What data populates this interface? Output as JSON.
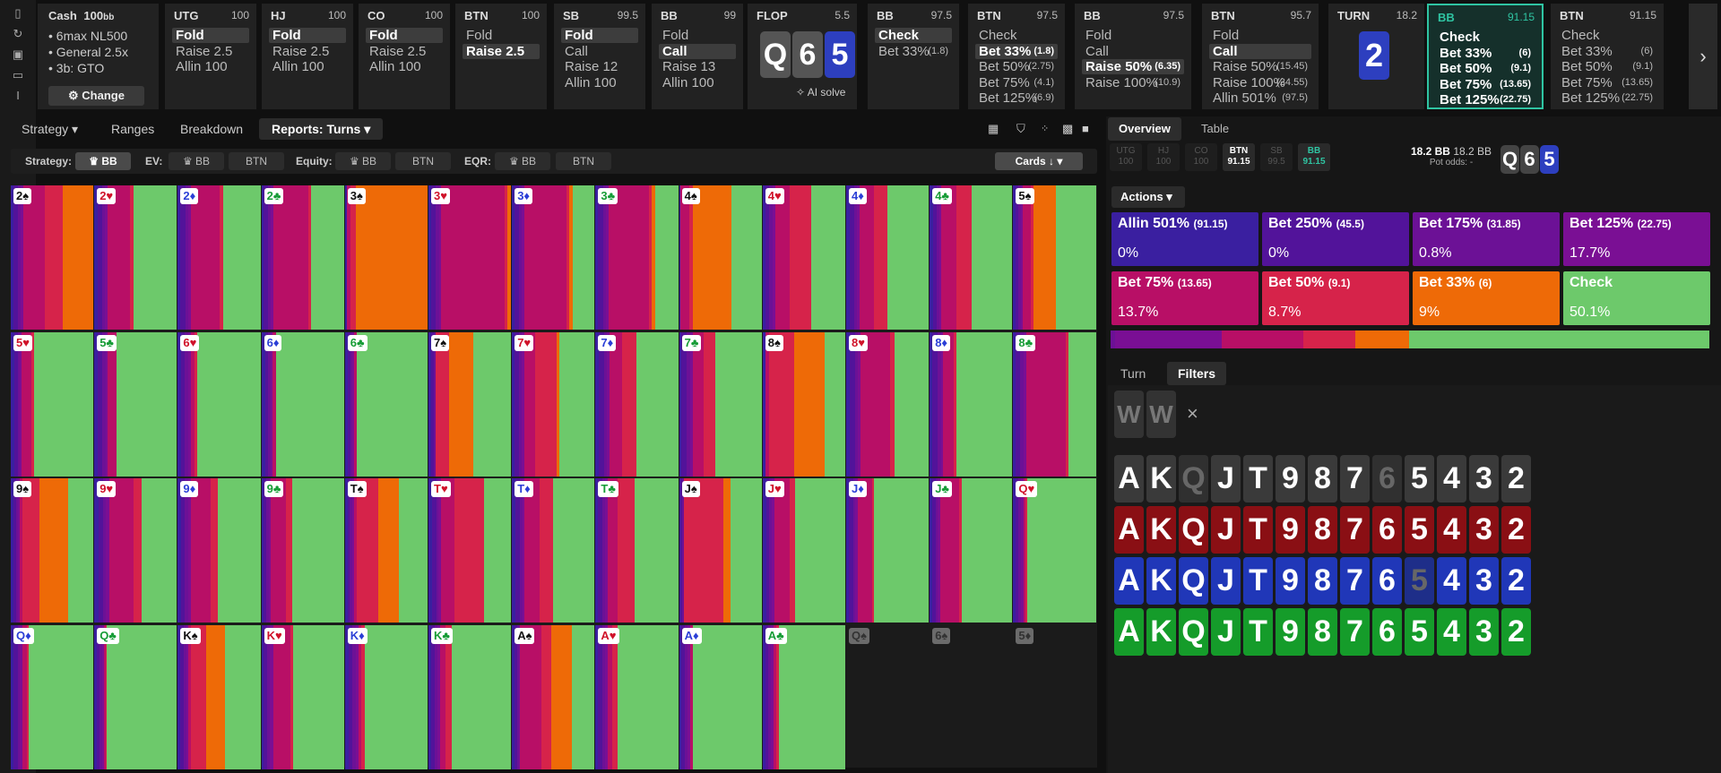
{
  "header": {
    "cash": "Cash",
    "stake": "100",
    "stake_unit": "bb",
    "bullets": [
      "6max NL500",
      "General 2.5x",
      "3b: GTO"
    ],
    "change": "Change",
    "ai_solve": "AI solve"
  },
  "columns": [
    {
      "name": "UTG",
      "stack": "100",
      "opts": [
        {
          "l": "Fold",
          "sel": true
        },
        {
          "l": "Raise 2.5"
        },
        {
          "l": "Allin 100"
        }
      ]
    },
    {
      "name": "HJ",
      "stack": "100",
      "opts": [
        {
          "l": "Fold",
          "sel": true
        },
        {
          "l": "Raise 2.5"
        },
        {
          "l": "Allin 100"
        }
      ]
    },
    {
      "name": "CO",
      "stack": "100",
      "opts": [
        {
          "l": "Fold",
          "sel": true
        },
        {
          "l": "Raise 2.5"
        },
        {
          "l": "Allin 100"
        }
      ]
    },
    {
      "name": "BTN",
      "stack": "100",
      "opts": [
        {
          "l": "Fold"
        },
        {
          "l": "Raise 2.5",
          "sel": true
        }
      ]
    },
    {
      "name": "SB",
      "stack": "99.5",
      "opts": [
        {
          "l": "Fold",
          "sel": true
        },
        {
          "l": "Call"
        },
        {
          "l": "Raise 12"
        },
        {
          "l": "Allin 100"
        }
      ]
    },
    {
      "name": "BB",
      "stack": "99",
      "opts": [
        {
          "l": "Fold"
        },
        {
          "l": "Call",
          "sel": true
        },
        {
          "l": "Raise 13"
        },
        {
          "l": "Allin 100"
        }
      ]
    },
    {
      "name": "FLOP",
      "stack": "5.5",
      "flop": true
    },
    {
      "name": "BB",
      "stack": "97.5",
      "opts": [
        {
          "l": "Check",
          "sel": true
        },
        {
          "l": "Bet 33%",
          "a": "(1.8)"
        }
      ]
    },
    {
      "name": "BTN",
      "stack": "97.5",
      "opts": [
        {
          "l": "Check"
        },
        {
          "l": "Bet 33%",
          "a": "(1.8)",
          "sel": true
        },
        {
          "l": "Bet 50%",
          "a": "(2.75)"
        },
        {
          "l": "Bet 75%",
          "a": "(4.1)"
        },
        {
          "l": "Bet 125%",
          "a": "(6.9)"
        }
      ]
    },
    {
      "name": "BB",
      "stack": "97.5",
      "opts": [
        {
          "l": "Fold"
        },
        {
          "l": "Call"
        },
        {
          "l": "Raise 50%",
          "a": "(6.35)",
          "sel": true
        },
        {
          "l": "Raise 100%",
          "a": "(10.9)"
        }
      ]
    },
    {
      "name": "BTN",
      "stack": "95.7",
      "opts": [
        {
          "l": "Fold"
        },
        {
          "l": "Call",
          "sel": true
        },
        {
          "l": "Raise 50%",
          "a": "(15.45)"
        },
        {
          "l": "Raise 100%",
          "a": "(24.55)"
        },
        {
          "l": "Allin 501%",
          "a": "(97.5)"
        }
      ]
    },
    {
      "name": "TURN",
      "stack": "18.2",
      "turn": true
    },
    {
      "name": "BB",
      "stack": "91.15",
      "active": true,
      "opts": [
        {
          "l": "Check",
          "b": true
        },
        {
          "l": "Bet 33%",
          "a": "(6)",
          "b": true
        },
        {
          "l": "Bet 50%",
          "a": "(9.1)",
          "b": true
        },
        {
          "l": "Bet 75%",
          "a": "(13.65)",
          "b": true
        },
        {
          "l": "Bet 125%",
          "a": "(22.75)",
          "b": true
        }
      ]
    },
    {
      "name": "BTN",
      "stack": "91.15",
      "opts": [
        {
          "l": "Check"
        },
        {
          "l": "Bet 33%",
          "a": "(6)"
        },
        {
          "l": "Bet 50%",
          "a": "(9.1)"
        },
        {
          "l": "Bet 75%",
          "a": "(13.65)"
        },
        {
          "l": "Bet 125%",
          "a": "(22.75)"
        }
      ]
    }
  ],
  "board": {
    "flop": [
      {
        "r": "Q",
        "s": "x"
      },
      {
        "r": "6",
        "s": "x"
      },
      {
        "r": "5",
        "s": "d"
      }
    ],
    "turn": {
      "r": "2",
      "s": "d"
    }
  },
  "tabs": [
    "Strategy",
    "Ranges",
    "Breakdown",
    "Reports: Turns"
  ],
  "filters": {
    "strategy": "Strategy:",
    "ev": "EV:",
    "equity": "Equity:",
    "eqr": "EQR:",
    "bb": "BB",
    "btn": "BTN",
    "cards": "Cards"
  },
  "right": {
    "tabs": [
      "Overview",
      "Table"
    ],
    "positions": [
      {
        "n": "UTG",
        "v": "100"
      },
      {
        "n": "HJ",
        "v": "100"
      },
      {
        "n": "CO",
        "v": "100"
      },
      {
        "n": "BTN",
        "v": "91.15"
      },
      {
        "n": "SB",
        "v": "99.5"
      },
      {
        "n": "BB",
        "v": "91.15"
      }
    ],
    "pot1": "18.2 BB",
    "pot2": "18.2 BB",
    "pot_odds": "Pot odds: -",
    "actions_label": "Actions",
    "actions": [
      {
        "l": "Allin 501%",
        "a": "(91.15)",
        "p": "0%",
        "c": "#3a1fa0"
      },
      {
        "l": "Bet 250%",
        "a": "(45.5)",
        "p": "0%",
        "c": "#52139a"
      },
      {
        "l": "Bet 175%",
        "a": "(31.85)",
        "p": "0.8%",
        "c": "#6c1196"
      },
      {
        "l": "Bet 125%",
        "a": "(22.75)",
        "p": "17.7%",
        "c": "#7a0f94"
      },
      {
        "l": "Bet 75%",
        "a": "(13.65)",
        "p": "13.7%",
        "c": "#b80f66"
      },
      {
        "l": "Bet 50%",
        "a": "(9.1)",
        "p": "8.7%",
        "c": "#d6234a"
      },
      {
        "l": "Bet 33%",
        "a": "(6)",
        "p": "9%",
        "c": "#ee6a07"
      },
      {
        "l": "Check",
        "a": "",
        "p": "50.1%",
        "c": "#6dc96b"
      }
    ],
    "freq": [
      0.8,
      17.7,
      13.7,
      8.7,
      9,
      50.1
    ],
    "subtabs": [
      "Turn",
      "Filters"
    ],
    "filter_cards": [
      "W",
      "W"
    ],
    "close": "×",
    "ranks": [
      "A",
      "K",
      "Q",
      "J",
      "T",
      "9",
      "8",
      "7",
      "6",
      "5",
      "4",
      "3",
      "2"
    ]
  },
  "colors": {
    "check": "#6dc96b",
    "bet33": "#ee6a07",
    "bet50": "#d6234a",
    "bet75": "#b80f66",
    "bet125": "#7a0f94",
    "allin": "#3a1fa0"
  },
  "turn_cards": [
    {
      "c": "2♠",
      "st": "s",
      "m": [
        0.3,
        0.6,
        0.3,
        0.4,
        2.6,
        2.2,
        3.8,
        0
      ]
    },
    {
      "c": "2♥",
      "st": "h",
      "m": [
        0.4,
        0.5,
        0.3,
        0.3,
        2.6,
        0.5,
        0,
        5
      ]
    },
    {
      "c": "2♦",
      "st": "d",
      "m": [
        0.3,
        0.6,
        0.4,
        0.3,
        3.5,
        0.4,
        0,
        4.6
      ]
    },
    {
      "c": "2♣",
      "st": "c",
      "m": [
        0.3,
        0.5,
        0.3,
        0.4,
        4.2,
        0.4,
        0,
        4
      ]
    },
    {
      "c": "3♠",
      "st": "s",
      "m": [
        0.2,
        0,
        0,
        0,
        0.5,
        0.6,
        8.7,
        0
      ]
    },
    {
      "c": "3♥",
      "st": "h",
      "m": [
        0.3,
        0.5,
        0.4,
        0.3,
        7.4,
        0.3,
        0.4,
        0
      ]
    },
    {
      "c": "3♦",
      "st": "d",
      "m": [
        0.3,
        0.5,
        0.4,
        0.3,
        5.1,
        0.3,
        0.5,
        2.6
      ]
    },
    {
      "c": "3♣",
      "st": "c",
      "m": [
        0.3,
        0.6,
        0.3,
        0.4,
        4.8,
        0.3,
        0.5,
        2.7
      ]
    },
    {
      "c": "4♠",
      "st": "s",
      "m": [
        0.2,
        0,
        0,
        0,
        1,
        0.4,
        4.5,
        3.6
      ]
    },
    {
      "c": "4♥",
      "st": "h",
      "m": [
        0.3,
        0.5,
        0.4,
        0.3,
        1.7,
        2.5,
        0,
        4
      ]
    },
    {
      "c": "4♦",
      "st": "d",
      "m": [
        0.4,
        0.5,
        0.4,
        0.3,
        1.7,
        1.5,
        0,
        4.9
      ]
    },
    {
      "c": "4♣",
      "st": "c",
      "m": [
        0.4,
        0.4,
        0.3,
        0.3,
        1.7,
        1.8,
        0,
        4.8
      ]
    },
    {
      "c": "5♠",
      "st": "s",
      "m": [
        0.3,
        0.3,
        0.3,
        0.2,
        0.9,
        0.4,
        2.6,
        4.6
      ]
    },
    {
      "c": "5♥",
      "st": "h",
      "m": [
        0.4,
        0.4,
        0.3,
        0.2,
        1.1,
        0.3,
        0,
        7
      ]
    },
    {
      "c": "5♣",
      "st": "c",
      "m": [
        0.4,
        0.5,
        0.4,
        0.2,
        1.1,
        0,
        0,
        7
      ]
    },
    {
      "c": "6♥",
      "st": "h",
      "m": [
        0.4,
        0.4,
        0.4,
        0.3,
        0.4,
        0.3,
        0,
        7.2
      ]
    },
    {
      "c": "6♦",
      "st": "d",
      "m": [
        0.4,
        0.4,
        0.3,
        0.2,
        0.4,
        0,
        0,
        7.7
      ]
    },
    {
      "c": "6♣",
      "st": "c",
      "m": [
        0.3,
        0.3,
        0.2,
        0.2,
        0.4,
        0,
        0,
        8.1
      ]
    },
    {
      "c": "7♠",
      "st": "s",
      "m": [
        0.3,
        0.3,
        0.2,
        0,
        0,
        1.6,
        2.9,
        4.4
      ]
    },
    {
      "c": "7♥",
      "st": "h",
      "m": [
        0.3,
        0.5,
        0.3,
        0.3,
        1.3,
        2.5,
        0.3,
        4.1
      ]
    },
    {
      "c": "7♦",
      "st": "d",
      "m": [
        0.4,
        0.6,
        0.3,
        0.3,
        1.5,
        1.7,
        0,
        4.9
      ]
    },
    {
      "c": "7♣",
      "st": "c",
      "m": [
        0.3,
        0.6,
        0.4,
        0.3,
        1.3,
        1.4,
        0,
        5.4
      ]
    },
    {
      "c": "8♠",
      "st": "s",
      "m": [
        0.3,
        0,
        0,
        0,
        0.5,
        2.9,
        3.7,
        2.4
      ]
    },
    {
      "c": "8♥",
      "st": "h",
      "m": [
        0.4,
        0.6,
        0.4,
        0.3,
        3.5,
        0.5,
        0,
        4.0
      ]
    },
    {
      "c": "8♦",
      "st": "d",
      "m": [
        0.3,
        0.6,
        0.4,
        0.3,
        1.2,
        0.3,
        0,
        6.6
      ]
    },
    {
      "c": "8♣",
      "st": "c",
      "m": [
        0.3,
        0.5,
        0.4,
        0.3,
        4.7,
        0.3,
        0,
        3.2
      ]
    },
    {
      "c": "9♠",
      "st": "s",
      "m": [
        0.3,
        0.3,
        0.3,
        0.2,
        0.3,
        2.0,
        3.4,
        3.0
      ]
    },
    {
      "c": "9♥",
      "st": "h",
      "m": [
        0.5,
        0.5,
        0.4,
        0.4,
        2.8,
        1.0,
        0,
        4.1
      ]
    },
    {
      "c": "9♦",
      "st": "d",
      "m": [
        0.4,
        0.4,
        0.4,
        0.3,
        2.4,
        0.8,
        0,
        5.0
      ]
    },
    {
      "c": "9♣",
      "st": "c",
      "m": [
        0.3,
        0.3,
        0.3,
        0.2,
        1.8,
        0.7,
        0,
        6.1
      ]
    },
    {
      "c": "T♠",
      "st": "s",
      "m": [
        0.3,
        0.3,
        0.3,
        0.2,
        0.3,
        2.6,
        2.4,
        3.4
      ]
    },
    {
      "c": "T♥",
      "st": "h",
      "m": [
        0.4,
        0.5,
        0.3,
        0.3,
        1.5,
        3.5,
        0,
        3.2
      ]
    },
    {
      "c": "T♦",
      "st": "d",
      "m": [
        0.4,
        0.5,
        0.3,
        0.3,
        1.7,
        1.6,
        0,
        4.9
      ]
    },
    {
      "c": "T♣",
      "st": "c",
      "m": [
        0.3,
        0.5,
        0.3,
        0.3,
        1.2,
        2.0,
        0,
        5.1
      ]
    },
    {
      "c": "J♠",
      "st": "s",
      "m": [
        0.2,
        0.2,
        0.2,
        0,
        0,
        4.6,
        0.8,
        3.7
      ]
    },
    {
      "c": "J♥",
      "st": "h",
      "m": [
        0.4,
        0.4,
        0.3,
        0.3,
        1.8,
        0.6,
        0,
        5.9
      ]
    },
    {
      "c": "J♦",
      "st": "d",
      "m": [
        0.3,
        0.5,
        0.3,
        0.3,
        1.7,
        0.2,
        0,
        6.4
      ]
    },
    {
      "c": "J♣",
      "st": "c",
      "m": [
        0.3,
        0.4,
        0.3,
        0.3,
        2.3,
        0.3,
        0,
        6.1
      ]
    },
    {
      "c": "Q♥",
      "st": "h",
      "m": [
        0.3,
        0.3,
        0.3,
        0.3,
        0.2,
        0.3,
        0,
        8.1
      ]
    },
    {
      "c": "Q♦",
      "st": "d",
      "m": [
        0.3,
        0.5,
        0.3,
        0.3,
        0.5,
        0.2,
        0,
        7.6
      ]
    },
    {
      "c": "Q♣",
      "st": "c",
      "m": [
        0.3,
        0.3,
        0.3,
        0.2,
        0.2,
        0.2,
        0,
        8.2
      ]
    },
    {
      "c": "K♠",
      "st": "s",
      "m": [
        0.3,
        0.4,
        0.3,
        0.3,
        0.3,
        1.8,
        2.2,
        4.3
      ]
    },
    {
      "c": "K♥",
      "st": "h",
      "m": [
        0.3,
        0.4,
        0.3,
        0.4,
        2.0,
        0.3,
        0,
        6.0
      ]
    },
    {
      "c": "K♦",
      "st": "d",
      "m": [
        0.4,
        0.5,
        0.4,
        0.3,
        0.3,
        0.4,
        0,
        7.3
      ]
    },
    {
      "c": "K♣",
      "st": "c",
      "m": [
        0.3,
        0.5,
        0.3,
        0.3,
        0.6,
        0.8,
        0,
        7.1
      ]
    },
    {
      "c": "A♠",
      "st": "s",
      "m": [
        0.3,
        0.3,
        0.2,
        0.2,
        2.6,
        1.1,
        2.6,
        2.7
      ]
    },
    {
      "c": "A♥",
      "st": "h",
      "m": [
        0.3,
        0.5,
        0.3,
        0.3,
        0.6,
        0.6,
        0,
        7.1
      ]
    },
    {
      "c": "A♦",
      "st": "d",
      "m": [
        0.3,
        0.4,
        0.3,
        0.3,
        0.4,
        0,
        0,
        8.3
      ]
    },
    {
      "c": "A♣",
      "st": "c",
      "m": [
        0.3,
        0.4,
        0.3,
        0.3,
        0.4,
        0.3,
        0,
        8.2
      ]
    },
    {
      "c": "Q♠",
      "st": "x",
      "dim": true
    },
    {
      "c": "6♠",
      "st": "x",
      "dim": true
    },
    {
      "c": "5♦",
      "st": "x",
      "dim": true
    }
  ]
}
